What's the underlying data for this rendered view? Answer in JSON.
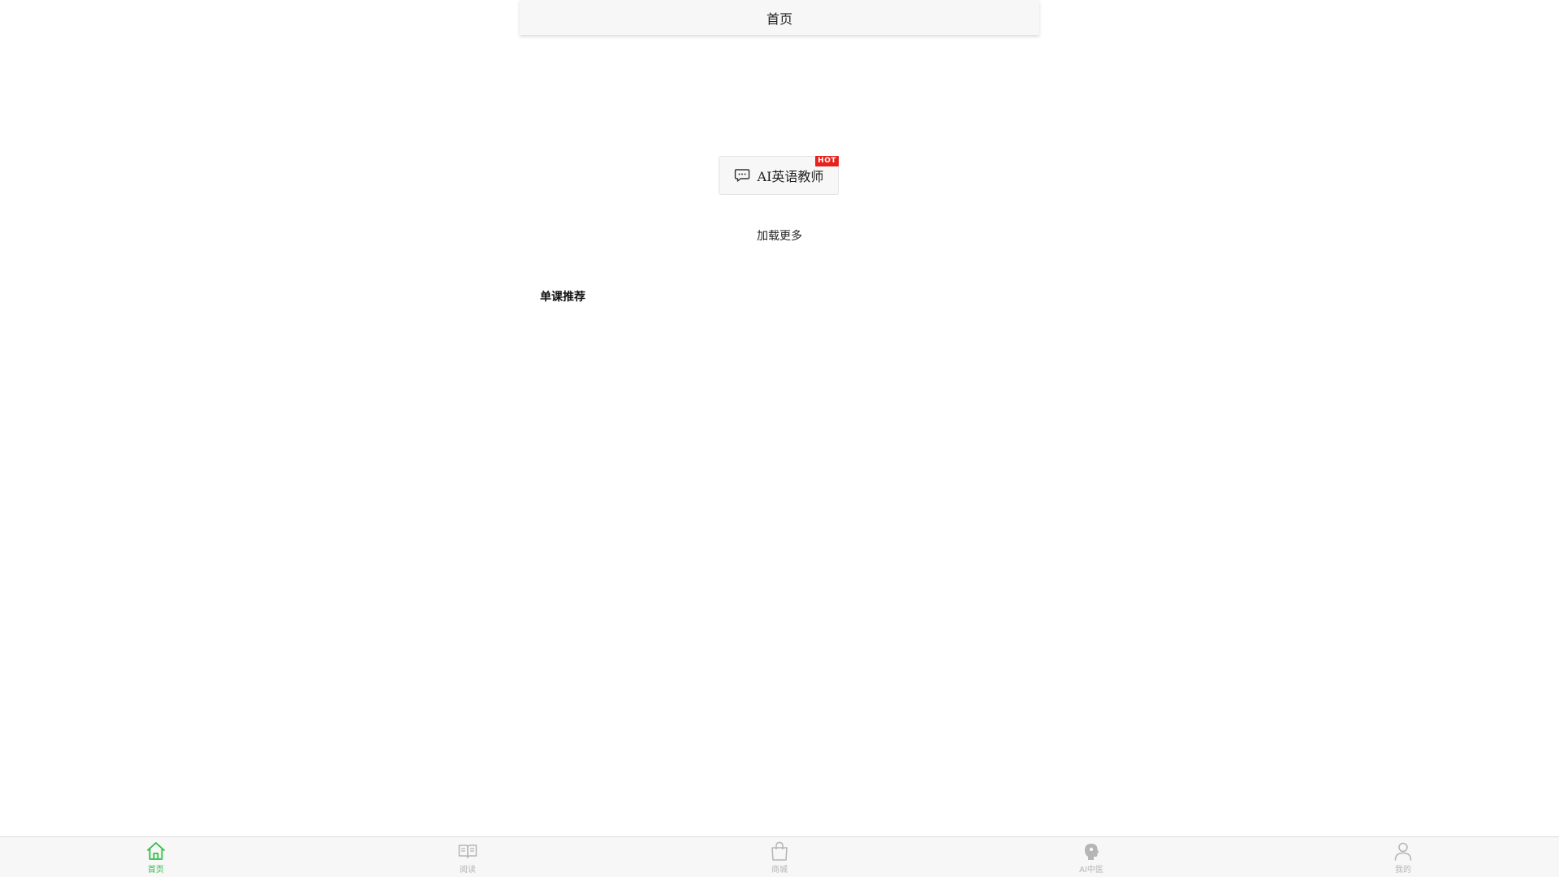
{
  "header": {
    "title": "首页"
  },
  "ai_teacher": {
    "label": "AI英语教师",
    "badge": "HOT",
    "icon": "chat-icon"
  },
  "load_more": {
    "label": "加载更多"
  },
  "section": {
    "title": "单课推荐"
  },
  "tabbar": {
    "active_color": "#2fbf45",
    "inactive_color": "#b5b5b5",
    "items": [
      {
        "label": "首页",
        "icon": "home-icon",
        "active": true
      },
      {
        "label": "阅读",
        "icon": "book-icon",
        "active": false
      },
      {
        "label": "商城",
        "icon": "shopping-bag-icon",
        "active": false
      },
      {
        "label": "AI中医",
        "icon": "ai-head-icon",
        "active": false
      },
      {
        "label": "我的",
        "icon": "user-icon",
        "active": false
      }
    ]
  }
}
